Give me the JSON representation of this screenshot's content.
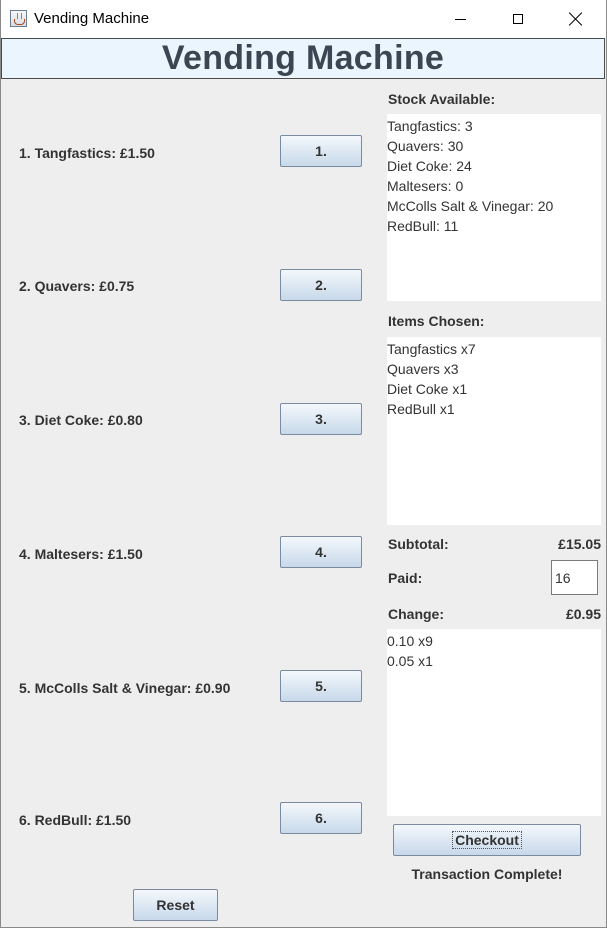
{
  "window": {
    "title": "Vending Machine",
    "icon": "java-cup-icon"
  },
  "header": {
    "title": "Vending Machine"
  },
  "items": [
    {
      "label": "1. Tangfastics: £1.50",
      "button": "1."
    },
    {
      "label": "2. Quavers: £0.75",
      "button": "2."
    },
    {
      "label": "3. Diet Coke: £0.80",
      "button": "3."
    },
    {
      "label": "4. Maltesers: £1.50",
      "button": "4."
    },
    {
      "label": "5. McColls Salt & Vinegar: £0.90",
      "button": "5."
    },
    {
      "label": "6. RedBull: £1.50",
      "button": "6."
    }
  ],
  "stock": {
    "label": "Stock Available:",
    "lines": [
      "Tangfastics: 3",
      "Quavers: 30",
      "Diet Coke: 24",
      "Maltesers: 0",
      "McColls Salt & Vinegar: 20",
      "RedBull: 11"
    ]
  },
  "chosen": {
    "label": "Items Chosen:",
    "lines": [
      "Tangfastics x7",
      "Quavers x3",
      "Diet Coke x1",
      "RedBull x1"
    ]
  },
  "subtotal": {
    "label": "Subtotal:",
    "value": "£15.05"
  },
  "paid": {
    "label": "Paid:",
    "value": "16"
  },
  "change": {
    "label": "Change:",
    "value": "£0.95",
    "lines": [
      "0.10 x9",
      "0.05 x1"
    ]
  },
  "checkout_label": "Checkout",
  "status": "Transaction Complete!",
  "reset_label": "Reset",
  "colors": {
    "header_bg": "#eaf5fd",
    "header_text": "#3c4552",
    "panel_bg": "#eeeeee",
    "button_gradient_top": "#f4f8fc",
    "button_gradient_bottom": "#c8d9ea"
  }
}
